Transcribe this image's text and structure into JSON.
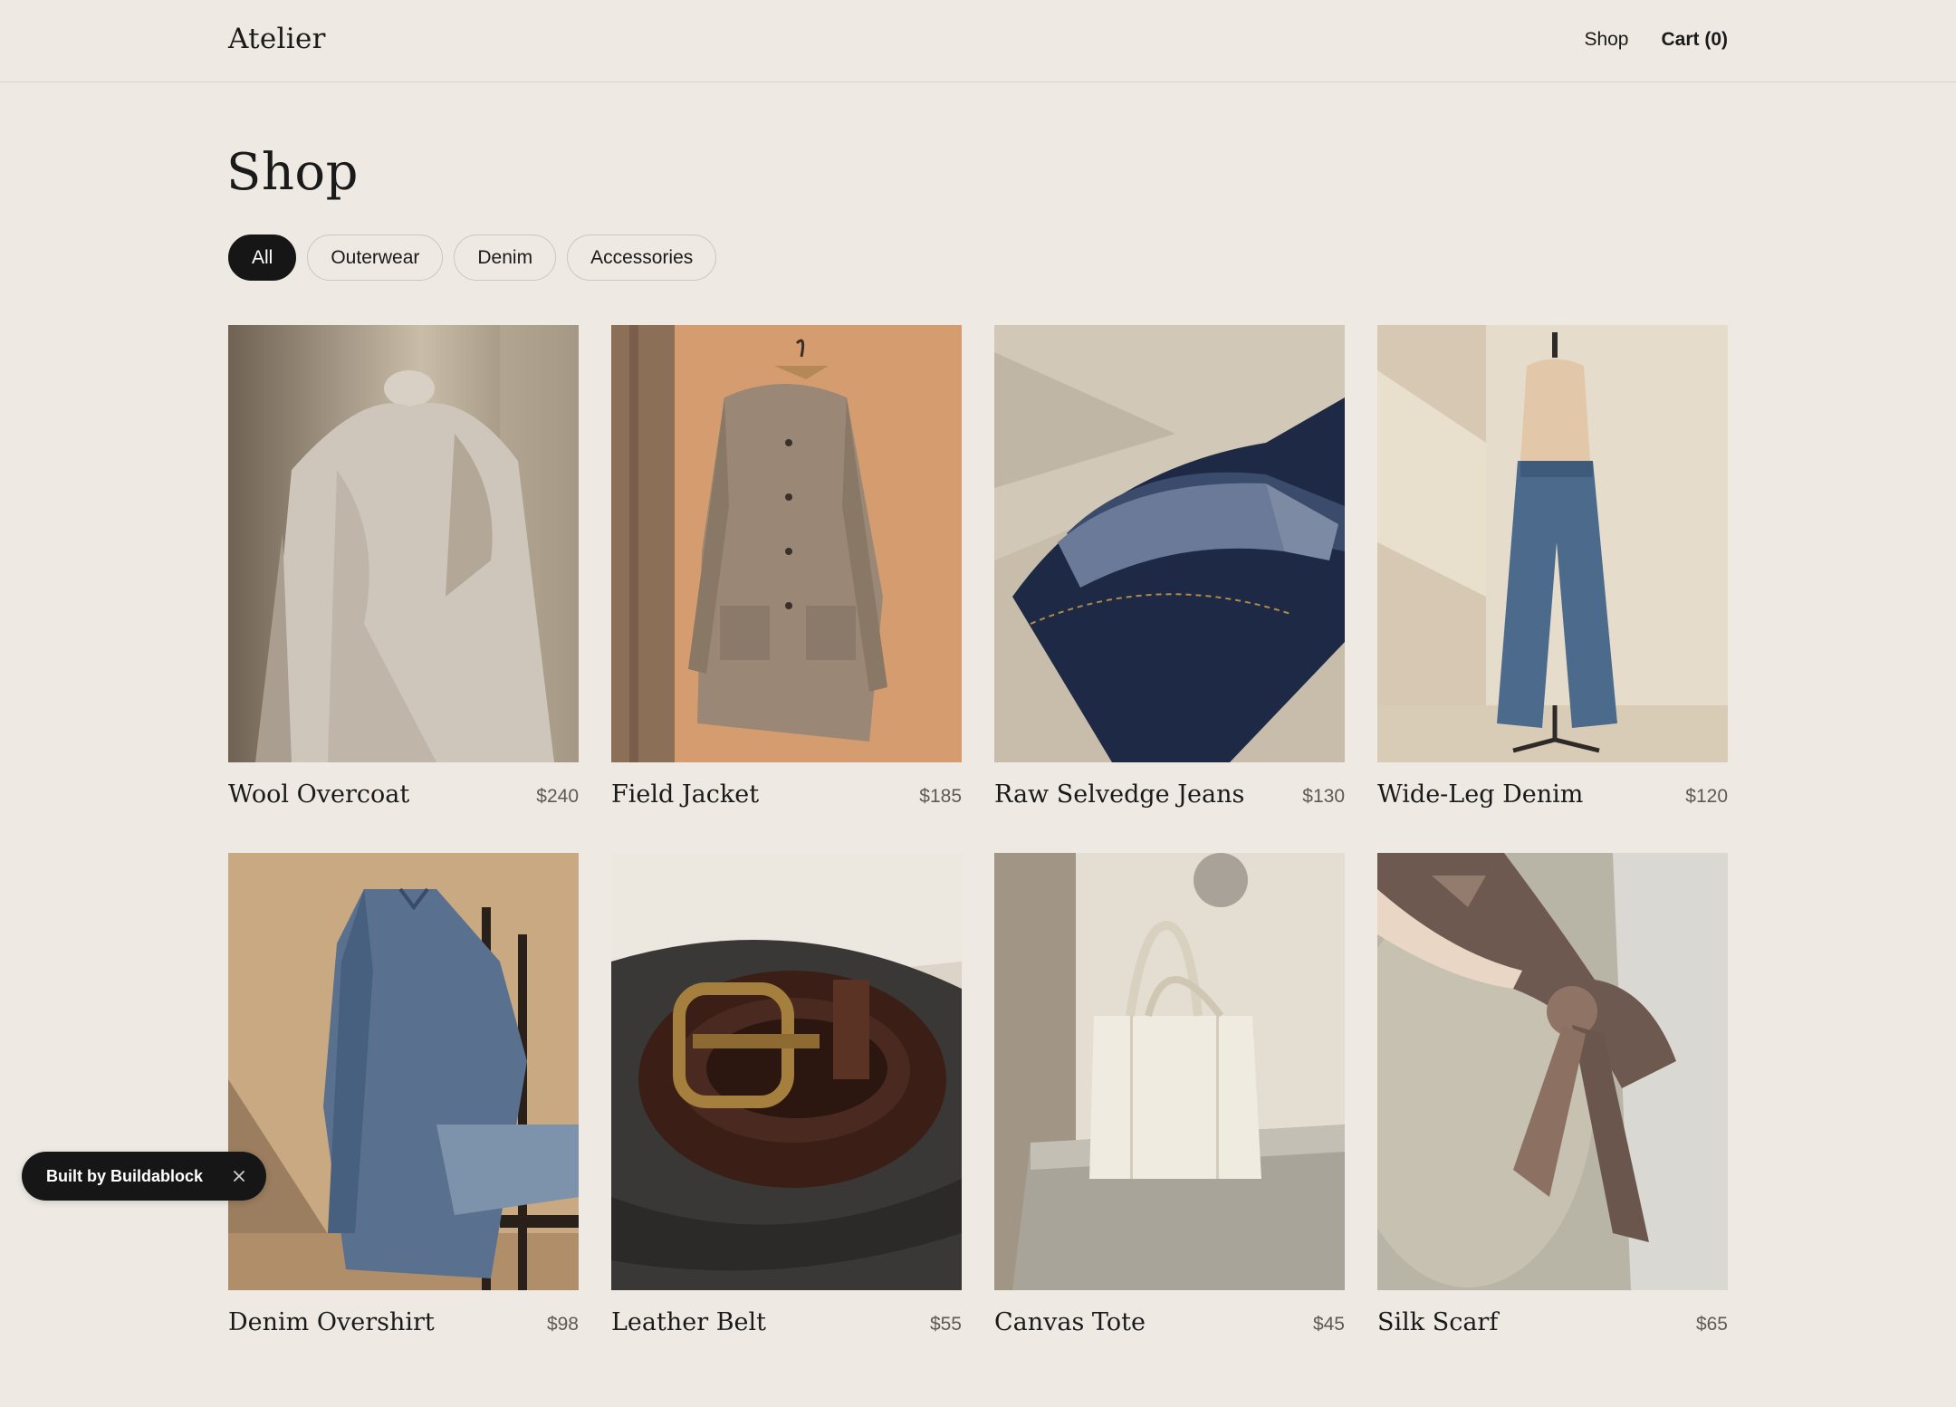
{
  "header": {
    "logo": "Atelier",
    "nav": {
      "shop": "Shop",
      "cart": "Cart (0)"
    }
  },
  "page": {
    "title": "Shop"
  },
  "filters": [
    "All",
    "Outerwear",
    "Denim",
    "Accessories"
  ],
  "active_filter": "All",
  "products": [
    {
      "name": "Wool Overcoat",
      "price": "$240",
      "image": "wool-overcoat-photo"
    },
    {
      "name": "Field Jacket",
      "price": "$185",
      "image": "field-jacket-photo"
    },
    {
      "name": "Raw Selvedge Jeans",
      "price": "$130",
      "image": "raw-selvedge-jeans-photo"
    },
    {
      "name": "Wide-Leg Denim",
      "price": "$120",
      "image": "wide-leg-denim-photo"
    },
    {
      "name": "Denim Overshirt",
      "price": "$98",
      "image": "denim-overshirt-photo"
    },
    {
      "name": "Leather Belt",
      "price": "$55",
      "image": "leather-belt-photo"
    },
    {
      "name": "Canvas Tote",
      "price": "$45",
      "image": "canvas-tote-photo"
    },
    {
      "name": "Silk Scarf",
      "price": "$65",
      "image": "silk-scarf-photo"
    }
  ],
  "badge": {
    "label": "Built by Buildablock",
    "close_icon": "close-icon"
  },
  "colors": {
    "background": "#eeeae3",
    "text": "#1a1a1a",
    "price": "#5e5a55",
    "chip_active": "#161616",
    "chip_border": "#cbc6be"
  }
}
